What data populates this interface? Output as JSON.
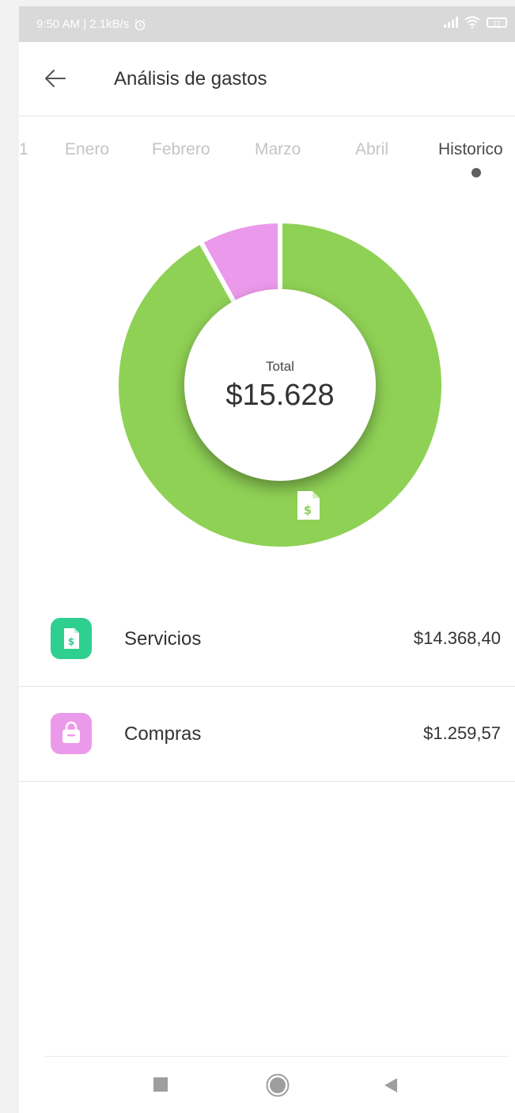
{
  "status_bar": {
    "time_speed": "9:50 AM | 2.1kB/s",
    "battery": "77",
    "icons": [
      "alarm-icon",
      "signal-icon",
      "wifi-icon",
      "battery-icon"
    ]
  },
  "app_bar": {
    "title": "Análisis de gastos",
    "back_icon": "arrow-left-icon"
  },
  "tabs": {
    "items": [
      {
        "label": "1"
      },
      {
        "label": "Enero"
      },
      {
        "label": "Febrero"
      },
      {
        "label": "Marzo"
      },
      {
        "label": "Abril"
      },
      {
        "label": "Historico"
      }
    ],
    "active": "Historico"
  },
  "summary": {
    "total_label": "Total",
    "total_value": "$15.628"
  },
  "chart_data": {
    "type": "pie",
    "categories": [
      "Servicios",
      "Compras"
    ],
    "values": [
      14368.4,
      1259.57
    ],
    "colors": [
      "#8fd155",
      "#eb9aeb"
    ],
    "total_label": "Total",
    "total_value": "$15.628"
  },
  "categories": [
    {
      "name": "Servicios",
      "amount": "$14.368,40",
      "icon": "invoice-dollar-icon",
      "color": "#2fcf8f"
    },
    {
      "name": "Compras",
      "amount": "$1.259,57",
      "icon": "shopping-bag-icon",
      "color": "#eb9aeb"
    }
  ],
  "nav_bar": {
    "icons": [
      "recents-square-icon",
      "home-circle-icon",
      "back-triangle-icon"
    ]
  }
}
